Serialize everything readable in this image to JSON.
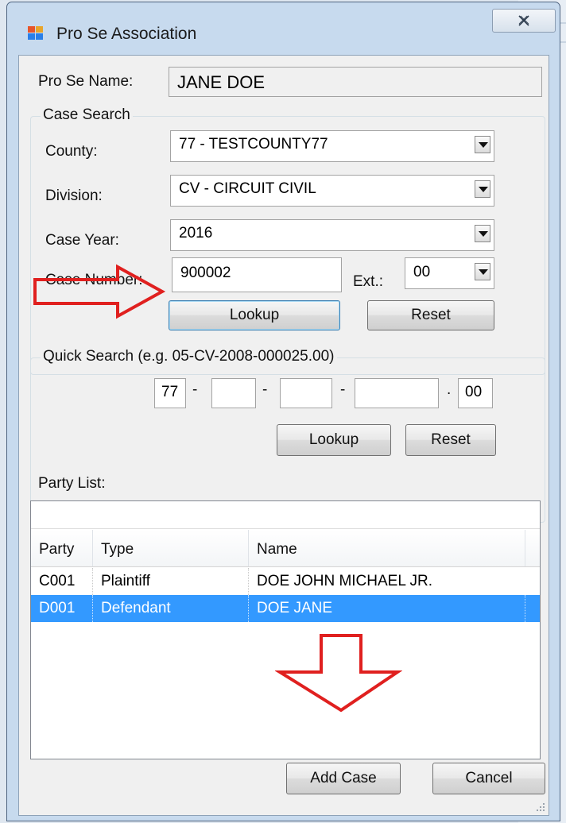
{
  "window": {
    "title": "Pro Se Association",
    "close_glyph": "☒"
  },
  "pro_se": {
    "label": "Pro Se Name:",
    "value": "JANE DOE"
  },
  "case_search": {
    "title": "Case Search",
    "county": {
      "label": "County:",
      "value": "77 - TESTCOUNTY77"
    },
    "division": {
      "label": "Division:",
      "value": "CV - CIRCUIT CIVIL"
    },
    "case_year": {
      "label": "Case Year:",
      "value": "2016"
    },
    "case_number": {
      "label": "Case Number:",
      "value": "900002"
    },
    "ext": {
      "label": "Ext.:",
      "value": "00"
    },
    "lookup_label": "Lookup",
    "reset_label": "Reset"
  },
  "quick_search": {
    "title": "Quick Search (e.g. 05-CV-2008-000025.00)",
    "county_value": "77",
    "division_value": "",
    "year_value": "",
    "number_value": "",
    "ext_value": "00",
    "sep_dash": "-",
    "sep_dot": ".",
    "lookup_label": "Lookup",
    "reset_label": "Reset"
  },
  "party_list": {
    "label": "Party List:",
    "filter_value": "",
    "columns": [
      "Party",
      "Type",
      "Name"
    ],
    "rows": [
      {
        "party": "C001",
        "type": "Plaintiff",
        "name": "DOE JOHN MICHAEL JR.",
        "selected": false
      },
      {
        "party": "D001",
        "type": "Defendant",
        "name": "DOE JANE",
        "selected": true
      }
    ]
  },
  "footer": {
    "add_case_label": "Add Case",
    "cancel_label": "Cancel"
  },
  "colors": {
    "selection": "#3399ff",
    "annotation_arrow": "#e0201f",
    "title_bar": "#c7daee"
  },
  "icons": {
    "app": "app-window-icon",
    "close": "close-icon",
    "dropdown": "chevron-down-icon"
  }
}
